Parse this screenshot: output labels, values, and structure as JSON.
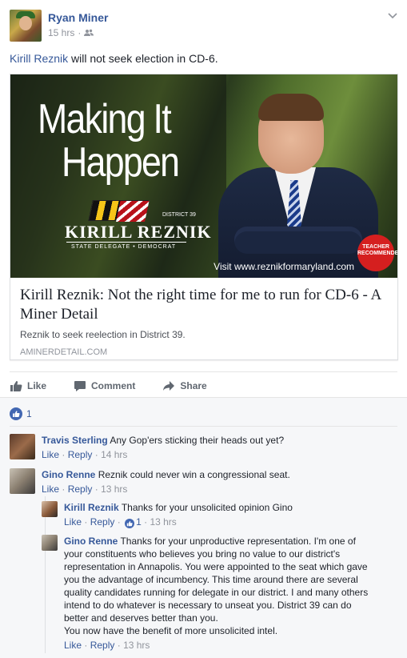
{
  "post": {
    "author": "Ryan Miner",
    "time": "15 hrs",
    "audience_icon": "friends-icon",
    "message": {
      "mention": "Kirill Reznik",
      "rest": " will not seek election in CD-6."
    }
  },
  "link": {
    "image_text": {
      "line1": "Making It",
      "line2": "Happen",
      "district": "DISTRICT 39",
      "name": "KIRILL REZNIK",
      "subtitle": "STATE DELEGATE • DEMOCRAT",
      "visit": "Visit www.reznikformaryland.com",
      "badge": "TEACHER RECOMMENDED"
    },
    "title": "Kirill Reznik: Not the right time for me to run for CD-6 - A Miner Detail",
    "description": "Reznik to seek reelection in District 39.",
    "domain": "AMINERDETAIL.COM"
  },
  "actions": {
    "like": "Like",
    "comment": "Comment",
    "share": "Share"
  },
  "reactions": {
    "count": "1"
  },
  "comments": [
    {
      "name": "Travis Sterling",
      "text": "Any Gop'ers sticking their heads out yet?",
      "like": "Like",
      "reply": "Reply",
      "time": "14 hrs"
    },
    {
      "name": "Gino Renne",
      "text": "Reznik could never win a congressional seat.",
      "like": "Like",
      "reply": "Reply",
      "time": "13 hrs"
    }
  ],
  "replies": [
    {
      "name": "Kirill Reznik",
      "text": "Thanks for your unsolicited opinion Gino",
      "like": "Like",
      "reply": "Reply",
      "likes": "1",
      "time": "13 hrs"
    },
    {
      "name": "Gino Renne",
      "text_lines": [
        "Thanks for your unproductive representation. I'm one of",
        "your constituents who believes you bring no value to our district's",
        "representation in Annapolis. You were appointed to the seat which gave",
        "you the advantage of incumbency. This time around there are several",
        "quality candidates running for delegate in our district. I and many others",
        "intend to do whatever is necessary to unseat you. District 39 can do",
        "better and deserves better than you.",
        "You now have the benefit of more unsolicited intel."
      ],
      "like": "Like",
      "reply": "Reply",
      "time": "13 hrs"
    }
  ],
  "colors": {
    "link_blue": "#365899",
    "like_blue": "#4267b2",
    "meta_gray": "#90949c",
    "comment_bg": "#f6f7f9"
  }
}
